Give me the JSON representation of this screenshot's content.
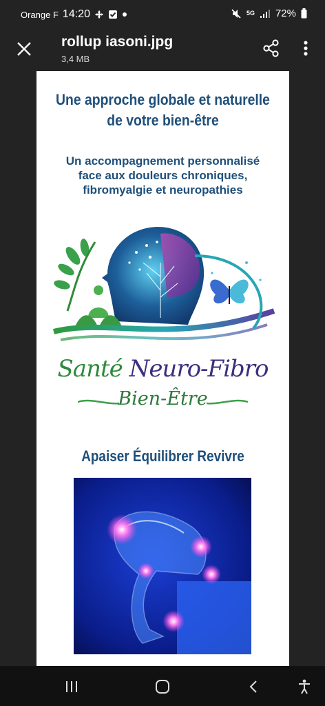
{
  "status_bar": {
    "carrier": "Orange F",
    "time": "14:20",
    "network": "5G",
    "battery": "72%"
  },
  "viewer": {
    "file_name": "rollup iasoni.jpg",
    "file_size": "3,4 MB"
  },
  "poster": {
    "headline": [
      "Une approche globale et naturelle",
      "de votre bien-être"
    ],
    "subheadline": [
      "Un accompagnement personnalisé",
      "face aux douleurs chroniques,",
      "fibromyalgie et neuropathies"
    ],
    "brand_part1": "Santé ",
    "brand_part2": "Neuro-Fibro",
    "brand_line2": "Bien-Être",
    "tagline": "Apaiser Équilibrer Revivre"
  },
  "colors": {
    "background": "#232323",
    "poster_text": "#1f4f7a",
    "brand_green": "#2e8b3c",
    "brand_purple": "#3b2f7f"
  }
}
